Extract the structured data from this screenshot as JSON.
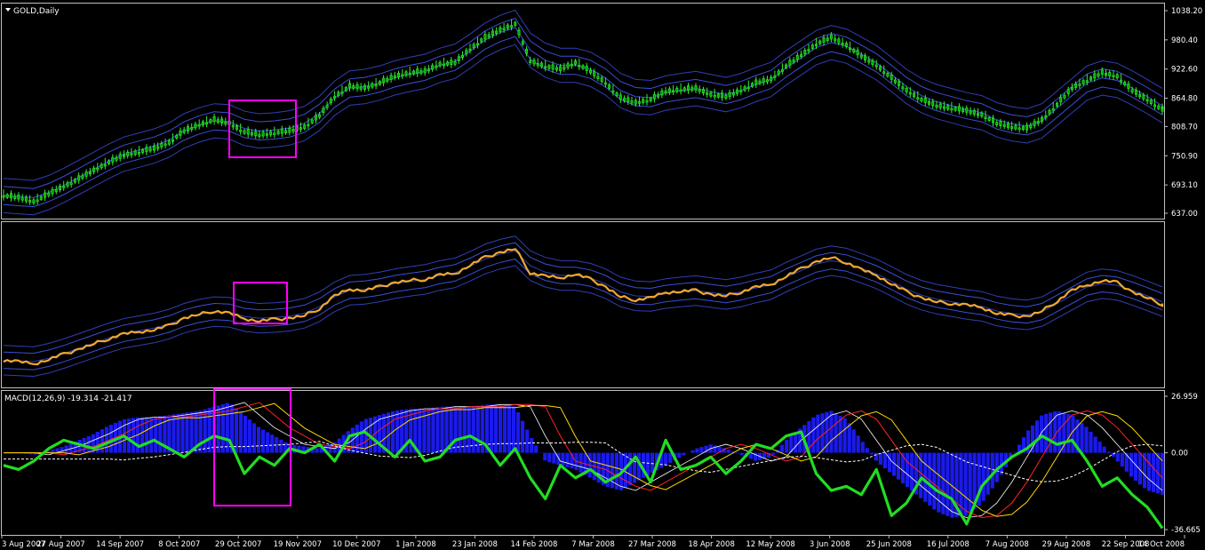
{
  "chart_data": [
    {
      "type": "line",
      "panel": "price",
      "title": "GOLD,Daily",
      "ylim": [
        637.0,
        1038.2
      ],
      "y_ticks": [
        "1038.20",
        "980.40",
        "922.60",
        "864.80",
        "808.70",
        "750.90",
        "693.10",
        "637.00"
      ],
      "series": [
        {
          "name": "",
          "kind": "candlestick",
          "values": [
            672,
            668,
            660,
            675,
            690,
            705,
            722,
            738,
            752,
            758,
            765,
            777,
            800,
            812,
            822,
            815,
            798,
            792,
            796,
            800,
            808,
            830,
            868,
            888,
            885,
            895,
            908,
            915,
            918,
            932,
            935,
            962,
            985,
            1000,
            1012,
            938,
            928,
            922,
            935,
            918,
            895,
            865,
            856,
            862,
            878,
            882,
            884,
            872,
            868,
            880,
            895,
            902,
            928,
            950,
            972,
            985,
            970,
            948,
            930,
            905,
            880,
            862,
            850,
            845,
            840,
            832,
            815,
            808,
            805,
            822,
            852,
            885,
            900,
            915,
            908,
            880,
            862,
            842
          ]
        },
        {
          "name": "",
          "kind": "band",
          "values": [
            672,
            670,
            668,
            678,
            692,
            708,
            724,
            740,
            754,
            762,
            770,
            782,
            800,
            812,
            820,
            818,
            805,
            800,
            802,
            806,
            815,
            835,
            865,
            885,
            888,
            895,
            905,
            912,
            918,
            930,
            938,
            958,
            980,
            995,
            1005,
            960,
            940,
            930,
            930,
            922,
            905,
            880,
            868,
            866,
            875,
            880,
            884,
            878,
            872,
            880,
            892,
            902,
            925,
            945,
            965,
            975,
            968,
            952,
            935,
            912,
            888,
            870,
            858,
            850,
            842,
            836,
            822,
            814,
            810,
            820,
            845,
            870,
            895,
            905,
            900,
            885,
            868,
            850
          ]
        }
      ]
    },
    {
      "type": "line",
      "panel": "close",
      "title": "",
      "series": [
        {
          "name": "",
          "values": [
            672,
            668,
            660,
            675,
            690,
            705,
            722,
            738,
            752,
            758,
            765,
            777,
            800,
            812,
            822,
            815,
            798,
            792,
            796,
            800,
            808,
            830,
            868,
            888,
            885,
            895,
            908,
            915,
            918,
            932,
            935,
            962,
            985,
            1000,
            1012,
            938,
            928,
            922,
            935,
            918,
            895,
            865,
            856,
            862,
            878,
            882,
            884,
            872,
            868,
            880,
            895,
            902,
            928,
            950,
            972,
            985,
            970,
            948,
            930,
            905,
            880,
            862,
            850,
            845,
            840,
            832,
            815,
            808,
            805,
            822,
            852,
            885,
            900,
            915,
            908,
            880,
            862,
            842
          ]
        }
      ]
    },
    {
      "type": "line",
      "panel": "macd",
      "title": "MACD(12,26,9) -19.314 -21.417",
      "ylim": [
        -36.665,
        26.959
      ],
      "y_ticks": [
        "26.959",
        "0.00",
        "-36.665"
      ],
      "x_ticks": [
        "3 Aug 2007",
        "27 Aug 2007",
        "14 Sep 2007",
        "8 Oct 2007",
        "29 Oct 2007",
        "19 Nov 2007",
        "10 Dec 2007",
        "1 Jan 2008",
        "23 Jan 2008",
        "14 Feb 2008",
        "7 Mar 2008",
        "27 Mar 2008",
        "18 Apr 2008",
        "12 May 2008",
        "3 Jun 2008",
        "25 Jun 2008",
        "16 Jul 2008",
        "7 Aug 2008",
        "29 Aug 2008",
        "22 Sep 2008",
        "14 Oct 2008"
      ],
      "series": [
        {
          "name": "",
          "kind": "histogram",
          "values": [
            0,
            0,
            -1,
            1,
            3,
            6,
            9,
            13,
            16,
            17,
            17,
            18,
            19,
            20,
            22,
            24,
            18,
            12,
            8,
            4,
            3,
            2,
            5,
            11,
            16,
            18,
            20,
            21,
            21,
            22,
            22,
            22,
            23,
            23,
            22,
            8,
            -4,
            -6,
            -8,
            -12,
            -16,
            -18,
            -14,
            -10,
            -6,
            -2,
            2,
            4,
            2,
            -1,
            -4,
            -2,
            6,
            12,
            18,
            20,
            16,
            6,
            -4,
            -10,
            -16,
            -22,
            -28,
            -31,
            -30,
            -24,
            -14,
            -2,
            10,
            18,
            20,
            18,
            12,
            4,
            -4,
            -12,
            -18,
            -20
          ]
        },
        {
          "name": "",
          "kind": "oscillator",
          "values": [
            -6,
            -8,
            -4,
            2,
            6,
            4,
            2,
            5,
            8,
            3,
            6,
            2,
            -2,
            4,
            8,
            6,
            -10,
            -2,
            -6,
            2,
            0,
            4,
            -4,
            8,
            10,
            4,
            -2,
            6,
            -4,
            -2,
            6,
            8,
            4,
            -6,
            2,
            -12,
            -22,
            -6,
            -12,
            -8,
            -14,
            -10,
            -2,
            -14,
            6,
            -8,
            -6,
            -2,
            -10,
            -4,
            4,
            2,
            8,
            10,
            -10,
            -18,
            -16,
            -20,
            -8,
            -30,
            -24,
            -12,
            -18,
            -22,
            -34,
            -16,
            -8,
            -2,
            2,
            8,
            4,
            6,
            -4,
            -16,
            -12,
            -20,
            -26,
            -36
          ]
        }
      ]
    }
  ]
}
